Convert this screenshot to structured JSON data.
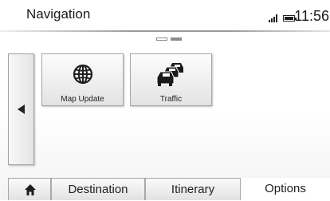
{
  "header": {
    "title": "Navigation",
    "signal_icon": "signal-bars-icon",
    "battery_icon": "battery-icon",
    "clock": "11:56"
  },
  "pager": {
    "pages": 2,
    "active_page": 2
  },
  "nav": {
    "left_arrow_icon": "arrow-left-icon"
  },
  "tiles": [
    {
      "label": "Map Update",
      "icon": "globe-icon"
    },
    {
      "label": "Traffic",
      "icon": "traffic-cars-icon"
    }
  ],
  "bottom": {
    "home_icon": "home-icon",
    "destination": "Destination",
    "itinerary": "Itinerary",
    "options": "Options"
  },
  "colors": {
    "text": "#1e1e1e",
    "border": "#a6a6a6",
    "background": "#ffffff"
  }
}
